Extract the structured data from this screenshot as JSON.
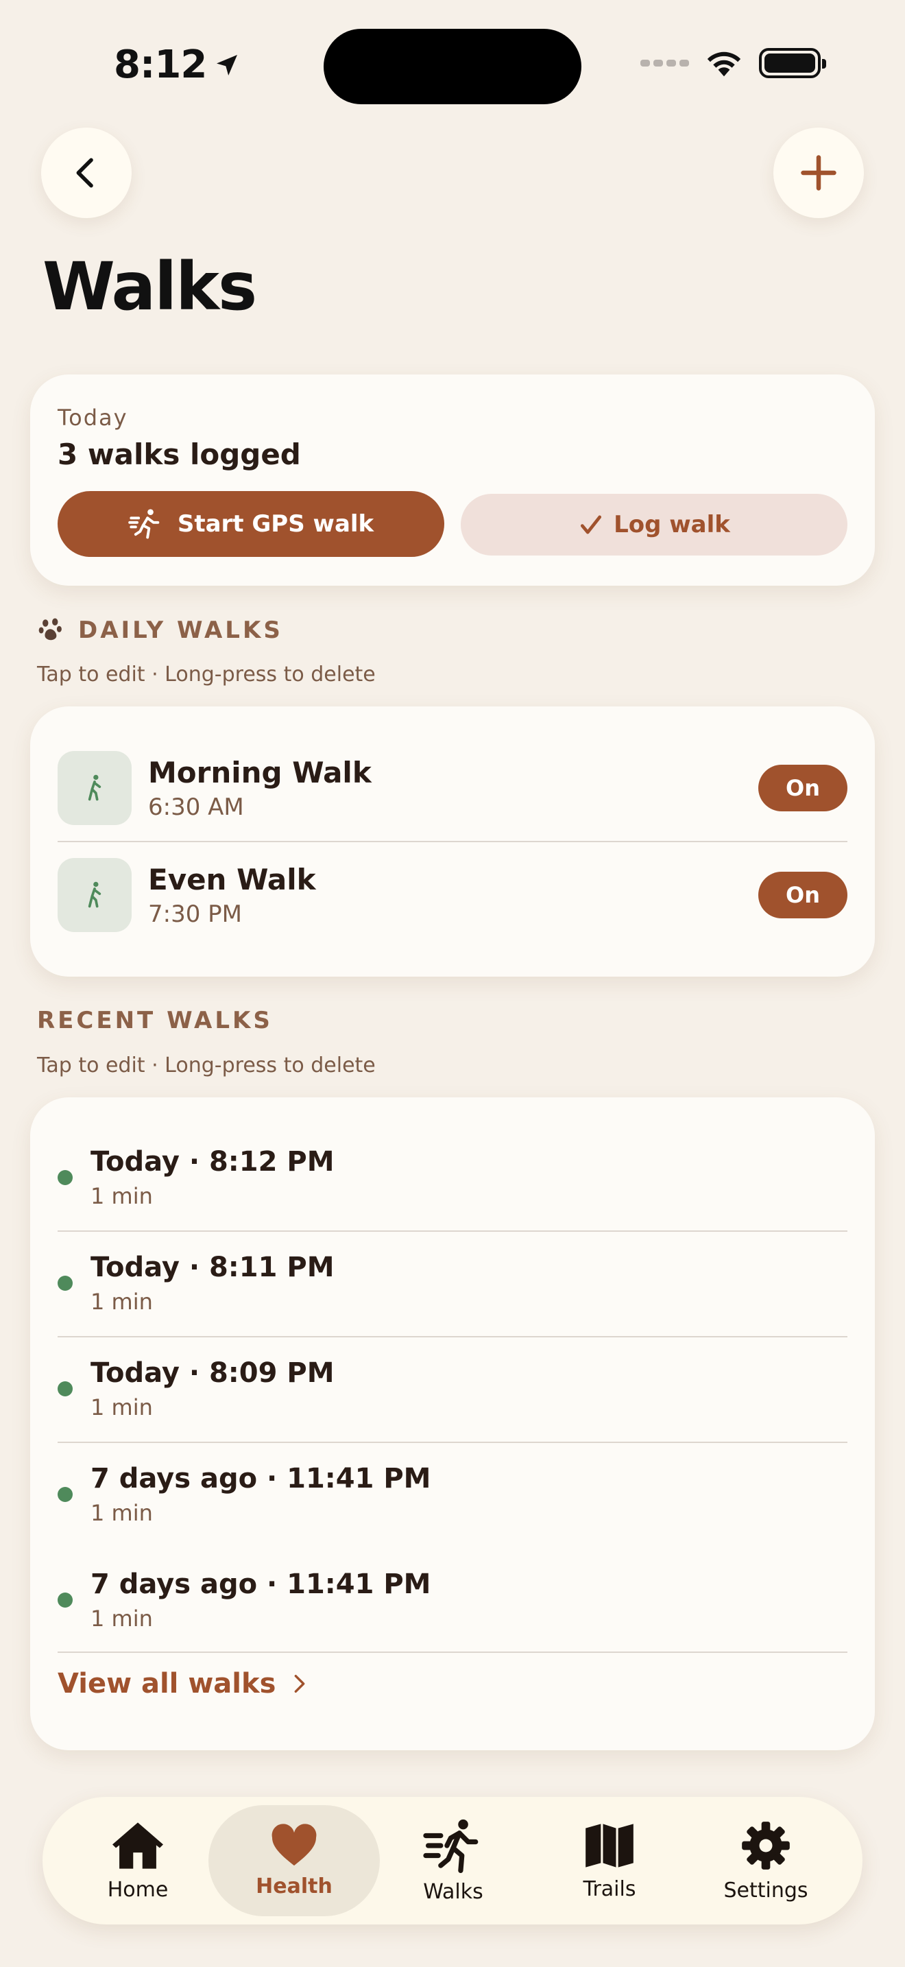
{
  "status_bar": {
    "time": "8:12"
  },
  "header": {
    "title": "Walks"
  },
  "today": {
    "label": "Today",
    "summary": "3 walks logged",
    "gps_button": "Start GPS walk",
    "log_button": "Log walk"
  },
  "daily": {
    "heading": "DAILY WALKS",
    "hint": "Tap to edit · Long-press to delete",
    "items": [
      {
        "name": "Morning Walk",
        "time": "6:30 AM",
        "toggle": "On"
      },
      {
        "name": "Even Walk",
        "time": "7:30 PM",
        "toggle": "On"
      }
    ]
  },
  "recent": {
    "heading": "RECENT WALKS",
    "hint": "Tap to edit · Long-press to delete",
    "items": [
      {
        "title": "Today · 8:12 PM",
        "duration": "1 min"
      },
      {
        "title": "Today · 8:11 PM",
        "duration": "1 min"
      },
      {
        "title": "Today · 8:09 PM",
        "duration": "1 min"
      },
      {
        "title": "7 days ago · 11:41 PM",
        "duration": "1 min"
      },
      {
        "title": "7 days ago · 11:41 PM",
        "duration": "1 min"
      }
    ],
    "view_all": "View all walks"
  },
  "tabs": [
    {
      "label": "Home",
      "icon": "home-icon",
      "active": false
    },
    {
      "label": "Health",
      "icon": "heart-icon",
      "active": true
    },
    {
      "label": "Walks",
      "icon": "walking-icon",
      "active": false
    },
    {
      "label": "Trails",
      "icon": "map-icon",
      "active": false
    },
    {
      "label": "Settings",
      "icon": "gear-icon",
      "active": false
    }
  ],
  "colors": {
    "accent": "#a0522d",
    "background": "#f6f0e8",
    "card": "#fdfbf7",
    "status_green": "#4f8a5b"
  }
}
